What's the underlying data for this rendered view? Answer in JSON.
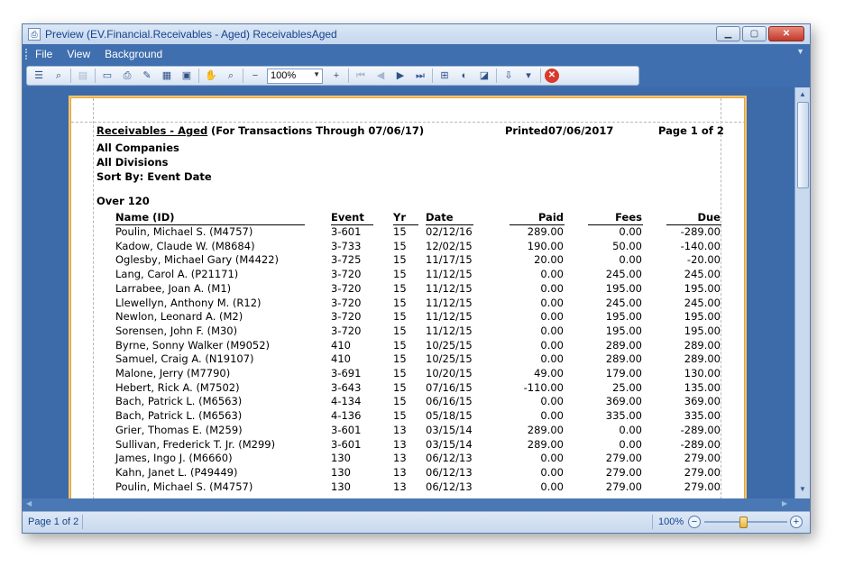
{
  "window": {
    "title": "Preview (EV.Financial.Receivables - Aged) ReceivablesAged",
    "menu": [
      "File",
      "View",
      "Background"
    ],
    "zoom_value": "100%"
  },
  "report": {
    "title": "Receivables - Aged",
    "subtitle": "(For Transactions Through 07/06/17)",
    "printed_label": "Printed",
    "printed_date": "07/06/2017",
    "page_info": "Page 1 of 2",
    "companies": "All Companies",
    "divisions": "All Divisions",
    "sort_by": "Sort By:  Event Date",
    "section": "Over 120",
    "columns": {
      "name": "Name (ID)",
      "event": "Event",
      "yr": "Yr",
      "date": "Date",
      "paid": "Paid",
      "fees": "Fees",
      "due": "Due"
    },
    "rows": [
      {
        "name": "Poulin, Michael S. (M4757)",
        "event": "3-601",
        "yr": "15",
        "date": "02/12/16",
        "paid": "289.00",
        "fees": "0.00",
        "due": "-289.00"
      },
      {
        "name": "Kadow, Claude W. (M8684)",
        "event": "3-733",
        "yr": "15",
        "date": "12/02/15",
        "paid": "190.00",
        "fees": "50.00",
        "due": "-140.00"
      },
      {
        "name": "Oglesby, Michael Gary (M4422)",
        "event": "3-725",
        "yr": "15",
        "date": "11/17/15",
        "paid": "20.00",
        "fees": "0.00",
        "due": "-20.00"
      },
      {
        "name": "Lang, Carol A. (P21171)",
        "event": "3-720",
        "yr": "15",
        "date": "11/12/15",
        "paid": "0.00",
        "fees": "245.00",
        "due": "245.00"
      },
      {
        "name": "Larrabee, Joan A. (M1)",
        "event": "3-720",
        "yr": "15",
        "date": "11/12/15",
        "paid": "0.00",
        "fees": "195.00",
        "due": "195.00"
      },
      {
        "name": "Llewellyn, Anthony M. (R12)",
        "event": "3-720",
        "yr": "15",
        "date": "11/12/15",
        "paid": "0.00",
        "fees": "245.00",
        "due": "245.00"
      },
      {
        "name": "Newlon, Leonard A. (M2)",
        "event": "3-720",
        "yr": "15",
        "date": "11/12/15",
        "paid": "0.00",
        "fees": "195.00",
        "due": "195.00"
      },
      {
        "name": "Sorensen, John F. (M30)",
        "event": "3-720",
        "yr": "15",
        "date": "11/12/15",
        "paid": "0.00",
        "fees": "195.00",
        "due": "195.00"
      },
      {
        "name": "Byrne, Sonny Walker (M9052)",
        "event": "410",
        "yr": "15",
        "date": "10/25/15",
        "paid": "0.00",
        "fees": "289.00",
        "due": "289.00"
      },
      {
        "name": "Samuel, Craig A. (N19107)",
        "event": "410",
        "yr": "15",
        "date": "10/25/15",
        "paid": "0.00",
        "fees": "289.00",
        "due": "289.00"
      },
      {
        "name": "Malone, Jerry (M7790)",
        "event": "3-691",
        "yr": "15",
        "date": "10/20/15",
        "paid": "49.00",
        "fees": "179.00",
        "due": "130.00"
      },
      {
        "name": "Hebert, Rick A. (M7502)",
        "event": "3-643",
        "yr": "15",
        "date": "07/16/15",
        "paid": "-110.00",
        "fees": "25.00",
        "due": "135.00"
      },
      {
        "name": "Bach, Patrick L. (M6563)",
        "event": "4-134",
        "yr": "15",
        "date": "06/16/15",
        "paid": "0.00",
        "fees": "369.00",
        "due": "369.00"
      },
      {
        "name": "Bach, Patrick L. (M6563)",
        "event": "4-136",
        "yr": "15",
        "date": "05/18/15",
        "paid": "0.00",
        "fees": "335.00",
        "due": "335.00"
      },
      {
        "name": "Grier, Thomas E. (M259)",
        "event": "3-601",
        "yr": "13",
        "date": "03/15/14",
        "paid": "289.00",
        "fees": "0.00",
        "due": "-289.00"
      },
      {
        "name": "Sullivan, Frederick T. Jr. (M299)",
        "event": "3-601",
        "yr": "13",
        "date": "03/15/14",
        "paid": "289.00",
        "fees": "0.00",
        "due": "-289.00"
      },
      {
        "name": "James, Ingo J. (M6660)",
        "event": "130",
        "yr": "13",
        "date": "06/12/13",
        "paid": "0.00",
        "fees": "279.00",
        "due": "279.00"
      },
      {
        "name": "Kahn, Janet L. (P49449)",
        "event": "130",
        "yr": "13",
        "date": "06/12/13",
        "paid": "0.00",
        "fees": "279.00",
        "due": "279.00"
      },
      {
        "name": "Poulin, Michael S. (M4757)",
        "event": "130",
        "yr": "13",
        "date": "06/12/13",
        "paid": "0.00",
        "fees": "279.00",
        "due": "279.00"
      }
    ]
  },
  "status": {
    "page": "Page 1 of 2",
    "zoom": "100%"
  },
  "icons": [
    "app-icon",
    "toc-icon",
    "find-icon",
    "open-icon",
    "print-icon",
    "print-preview-icon",
    "page-setup-icon",
    "hand-icon",
    "magnifier-icon",
    "zoom-out-icon",
    "zoom-in-icon",
    "first-page-icon",
    "prev-page-icon",
    "next-page-icon",
    "last-page-icon",
    "multipage-icon",
    "color-icon",
    "watermark-icon",
    "export-icon",
    "close-preview-icon"
  ]
}
